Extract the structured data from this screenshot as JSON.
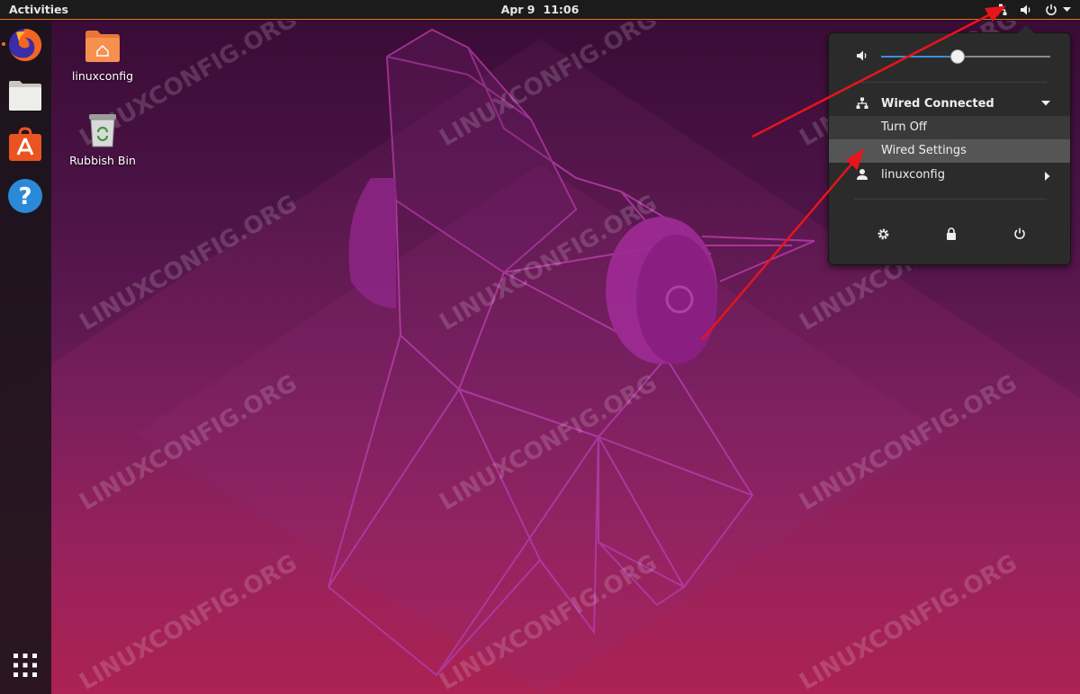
{
  "topbar": {
    "activities": "Activities",
    "date": "Apr 9",
    "time": "11:06",
    "tray_icons": [
      "network-wired-icon",
      "volume-icon",
      "power-icon",
      "chevron-down-icon"
    ]
  },
  "dock": {
    "items": [
      {
        "name": "firefox",
        "icon": "firefox-icon"
      },
      {
        "name": "files",
        "icon": "files-icon"
      },
      {
        "name": "software",
        "icon": "software-icon"
      },
      {
        "name": "help",
        "icon": "help-icon"
      }
    ],
    "apps_button": "show-applications-icon"
  },
  "desktop": {
    "icons": [
      {
        "label": "linuxconfig",
        "icon": "home-folder-icon"
      },
      {
        "label": "Rubbish Bin",
        "icon": "trash-icon"
      }
    ],
    "watermark": "LINUXCONFIG.ORG"
  },
  "system_menu": {
    "volume_level": 0.45,
    "network": {
      "label": "Wired Connected",
      "items": [
        "Turn Off",
        "Wired Settings"
      ]
    },
    "user": "linuxconfig",
    "actions": [
      "settings-icon",
      "lock-icon",
      "power-icon"
    ]
  },
  "colors": {
    "accent": "#e9731f",
    "annotation_arrow": "#e8141b",
    "slider_fill": "#3d8fd8"
  }
}
